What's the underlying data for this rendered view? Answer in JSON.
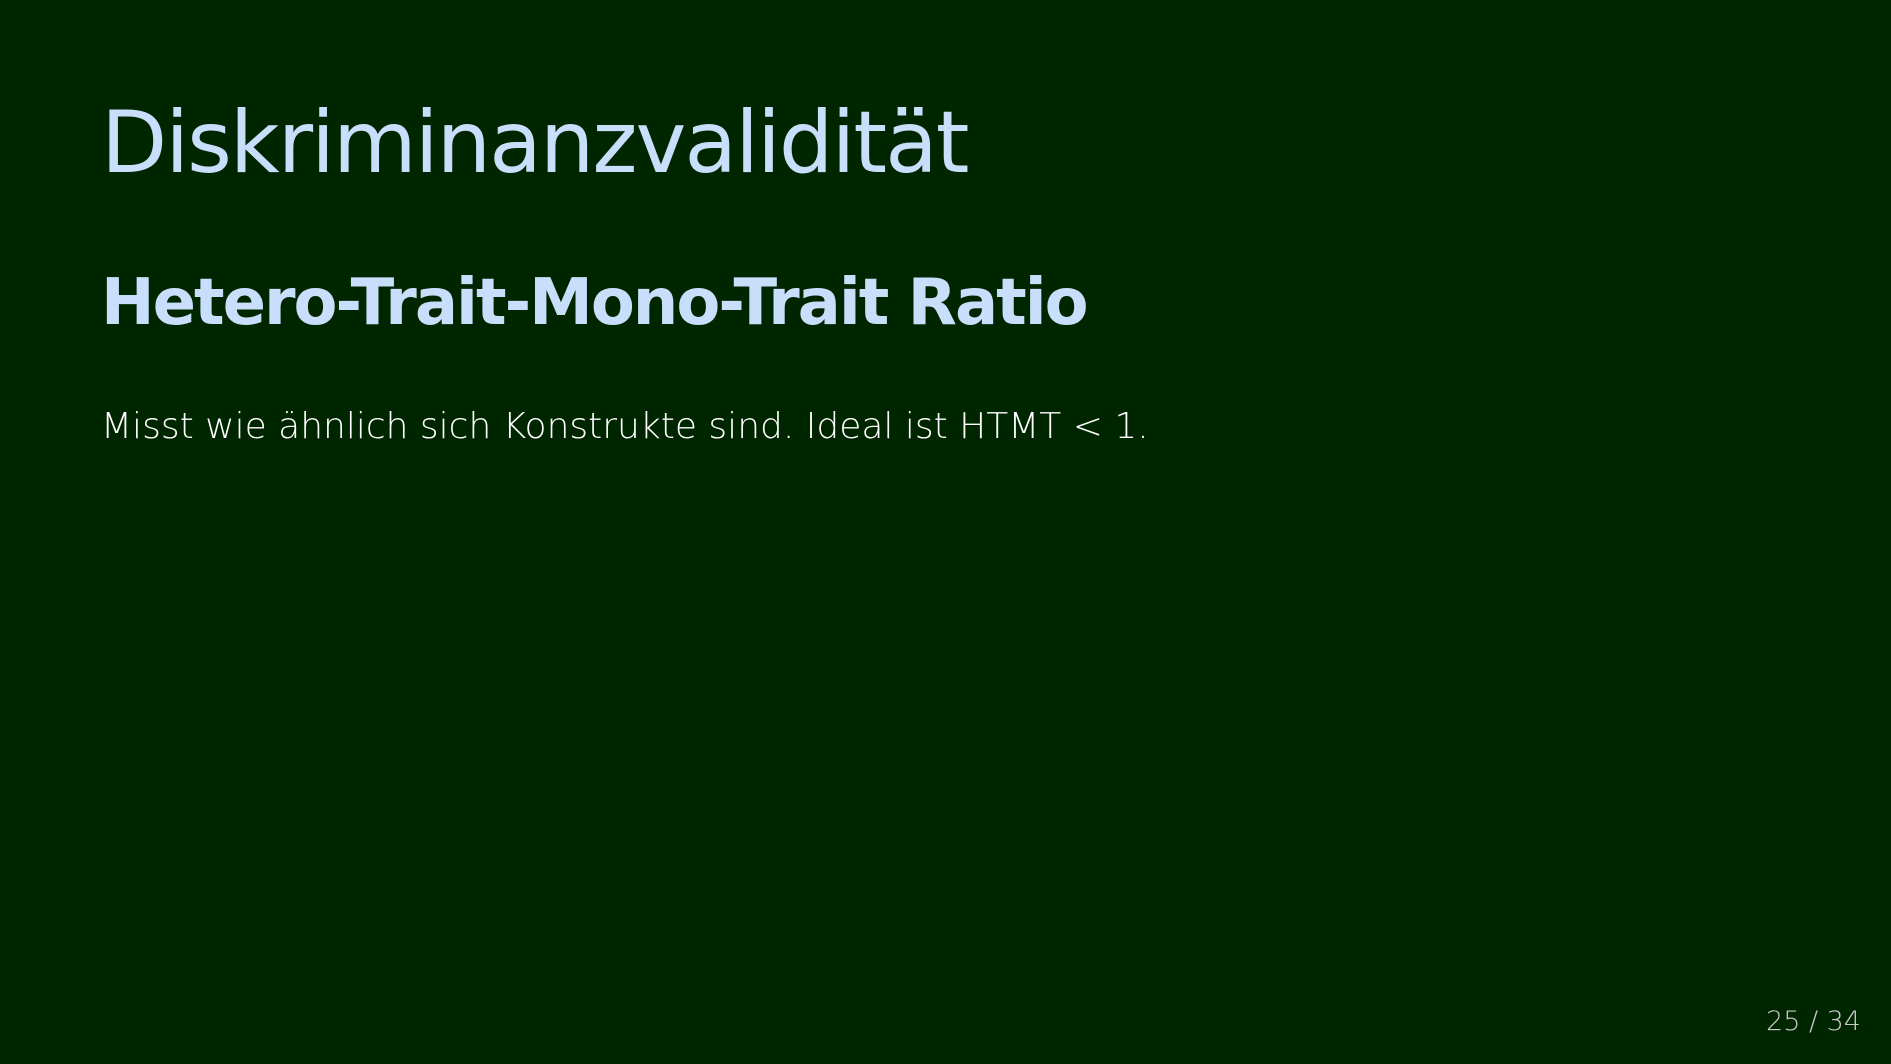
{
  "slide": {
    "title": "Diskriminanzvalidität",
    "subtitle": "Hetero-Trait-Mono-Trait Ratio",
    "body": "Misst wie ähnlich sich Konstrukte sind. Ideal ist HTMT < 1.",
    "page_number": "25 / 34"
  },
  "colors": {
    "background": "#002600",
    "heading": "#c9defa",
    "body_text": "#ffffff",
    "page_number": "#c9c9c9"
  }
}
